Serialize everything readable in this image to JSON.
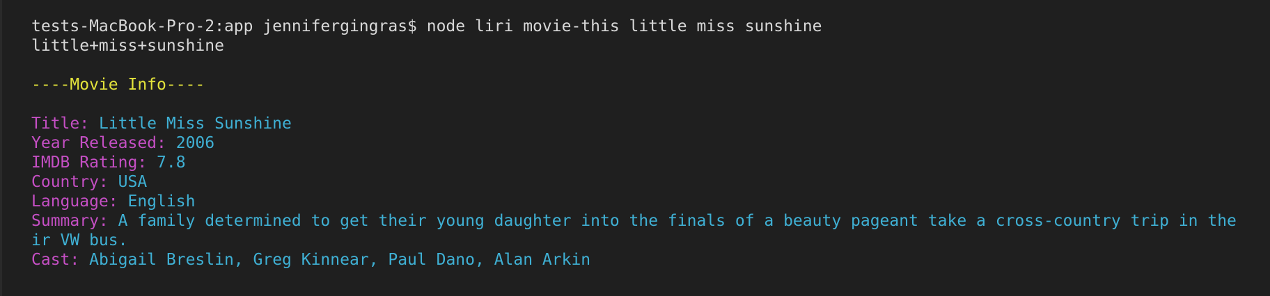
{
  "terminal": {
    "command_line": "tests-MacBook-Pro-2:app jennifergingras$ node liri movie-this little miss sunshine",
    "query_echo": "little+miss+sunshine",
    "section_header": "----Movie Info----",
    "fields": [
      {
        "label": "Title: ",
        "value": "Little Miss Sunshine"
      },
      {
        "label": "Year Released: ",
        "value": "2006"
      },
      {
        "label": "IMDB Rating: ",
        "value": "7.8"
      },
      {
        "label": "Country: ",
        "value": "USA"
      },
      {
        "label": "Language: ",
        "value": "English"
      },
      {
        "label": "Summary: ",
        "value": "A family determined to get their young daughter into the finals of a beauty pageant take a cross-country trip in the",
        "value_wrap": "ir VW bus."
      },
      {
        "label": "Cast: ",
        "value": "Abigail Breslin, Greg Kinnear, Paul Dano, Alan Arkin"
      }
    ]
  },
  "colors": {
    "background": "#1f1f1f",
    "default_text": "#d8d8d8",
    "header": "#e3e33b",
    "label": "#c54fc4",
    "value": "#3fb0d4"
  }
}
